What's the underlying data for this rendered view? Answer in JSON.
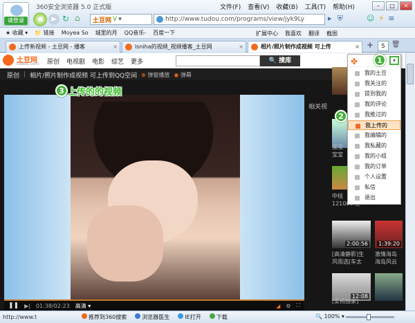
{
  "browser": {
    "title": "360安全浏览器 5.0 正式版",
    "login_label": "请登录",
    "menu": [
      "文件(F)",
      "查看(V)",
      "收藏(B)",
      "工具(T)",
      "帮助(H)"
    ],
    "search_engine": "土豆网",
    "search_engine_v": "V",
    "address": "http://www.tudou.com/programs/view/jyk9Ly",
    "bookmarks": [
      "收藏",
      "链接",
      "Moyea So",
      "城里的月",
      "QQ音乐-",
      "百度一下"
    ],
    "bookmarks_right": [
      "扩展中心",
      "我喜欢",
      "翻译",
      "截图"
    ],
    "tabs": [
      "上传新视频 - 土豆网 - 播客",
      "lsniha的视频_视频播客_土豆网",
      "相片/照片制作成视频 可上传"
    ],
    "tab_count": "5"
  },
  "site": {
    "logo_name": "土豆网",
    "logo_url": "tudou.com",
    "nav": [
      "原创",
      "电视剧",
      "电影",
      "综艺",
      "更多"
    ],
    "search_button": "搜库",
    "breadcrumb_root": "原创",
    "video_title": "相片/照片制作成视频 可上传到QQ空间",
    "popup_play": "弹窗播放",
    "danmu": "弹幕",
    "related_label": "相关视",
    "annotation_text": "上传的的视频",
    "player_time": "01:38/02:23",
    "quality": "高清"
  },
  "badges": [
    "1",
    "2",
    "3"
  ],
  "dropdown": {
    "items": [
      "我的土豆",
      "我关注的",
      "提到我的",
      "我的评论",
      "我推过的",
      "我上传的",
      "我编辑的",
      "我私藏的",
      "我的小组",
      "我的订单",
      "个人设置",
      "私信",
      "退出"
    ],
    "highlighted_index": 5
  },
  "sidebar": {
    "videos": [
      {
        "title_line1": "宝宝",
        "title_line2": "宝宝",
        "time": ""
      },
      {
        "title_line1": "中枝",
        "title_line2": "121001 生",
        "time": ""
      },
      {
        "title_line1": "[高清静影]生",
        "title_line2": "风雨选[车太",
        "time": "2:00:56"
      },
      {
        "title_line1": "激情海岛",
        "title_line2": "海岛风云",
        "time": "1:39:20"
      },
      {
        "title_line1": "[爱杨独家]",
        "title_line2": "",
        "time": "12:08"
      }
    ]
  },
  "status": {
    "url": "http://www.t",
    "items": [
      "推荐到360搜索",
      "浏览器医生",
      "IE打开",
      "下载"
    ],
    "zoom": "100%"
  }
}
